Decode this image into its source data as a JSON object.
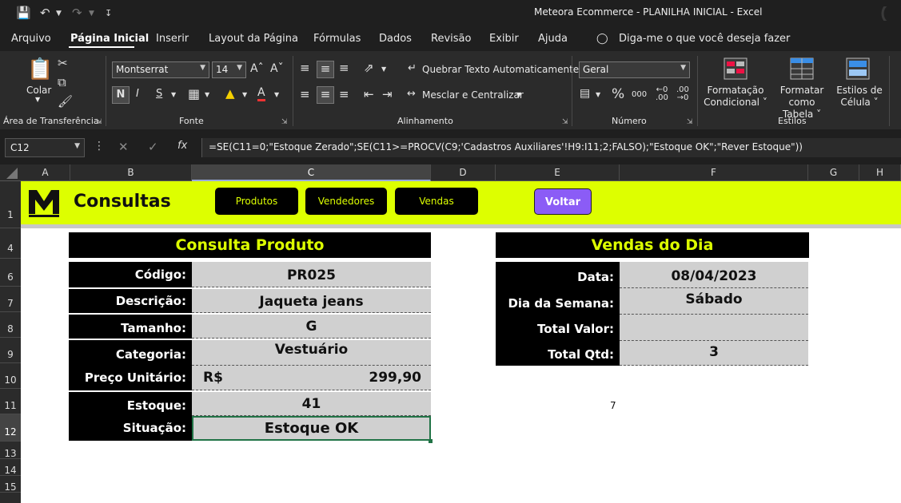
{
  "window": {
    "title": "Meteora Ecommerce - PLANILHA INICIAL  -  Excel"
  },
  "menu": {
    "items": [
      "Arquivo",
      "Página Inicial",
      "Inserir",
      "Layout da Página",
      "Fórmulas",
      "Dados",
      "Revisão",
      "Exibir",
      "Ajuda"
    ],
    "active": "Página Inicial",
    "tell_me": "Diga-me o que você deseja fazer"
  },
  "ribbon": {
    "clipboard": {
      "group": "Área de Transferência",
      "paste": "Colar"
    },
    "font": {
      "group": "Fonte",
      "name": "Montserrat",
      "size": "14",
      "bold": "N",
      "italic": "I",
      "underline": "S"
    },
    "alignment": {
      "group": "Alinhamento",
      "wrap": "Quebrar Texto Automaticamente",
      "merge": "Mesclar e Centralizar"
    },
    "number": {
      "group": "Número",
      "format": "Geral",
      "thousands": "000"
    },
    "styles": {
      "group": "Estilos",
      "conditional": [
        "Formatação",
        "Condicional"
      ],
      "table": [
        "Formatar como",
        "Tabela"
      ],
      "cell": [
        "Estilos de",
        "Célula"
      ]
    }
  },
  "formula_bar": {
    "name_box": "C12",
    "fx": "fx",
    "formula": "=SE(C11=0;\"Estoque Zerado\";SE(C11>=PROCV(C9;'Cadastros Auxiliares'!H9:I11;2;FALSO);\"Estoque OK\";\"Rever Estoque\"))"
  },
  "columns": [
    "A",
    "B",
    "C",
    "D",
    "E",
    "F",
    "G",
    "H"
  ],
  "rows": [
    "1",
    "4",
    "6",
    "7",
    "8",
    "9",
    "10",
    "11",
    "12",
    "13",
    "14",
    "15"
  ],
  "sheet": {
    "banner": {
      "title": "Consultas",
      "buttons": [
        "Produtos",
        "Vendedores",
        "Vendas"
      ],
      "back": "Voltar"
    },
    "produto": {
      "header": "Consulta Produto",
      "fields": [
        {
          "label": "Código:",
          "value": "PR025"
        },
        {
          "label": "Descrição:",
          "value": "Jaqueta jeans"
        },
        {
          "label": "Tamanho:",
          "value": "G"
        },
        {
          "label": "Categoria:",
          "value": "Vestuário"
        },
        {
          "label": "Preço Unitário:",
          "currency": "R$",
          "value": "299,90"
        },
        {
          "label": "Estoque:",
          "value": "41"
        },
        {
          "label": "Situação:",
          "value": "Estoque OK"
        }
      ]
    },
    "vendas": {
      "header": "Vendas do Dia",
      "fields": [
        {
          "label": "Data:",
          "value": "08/04/2023"
        },
        {
          "label": "Dia da Semana:",
          "value": "Sábado"
        },
        {
          "label": "Total Valor:",
          "value": ""
        },
        {
          "label": "Total Qtd:",
          "value": "3"
        }
      ]
    },
    "loose_value": "7"
  }
}
